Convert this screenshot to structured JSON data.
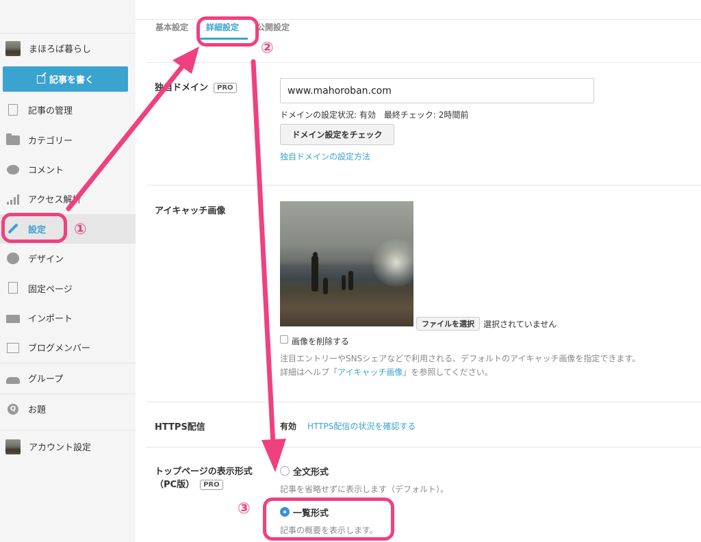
{
  "sidebar": {
    "blog_name": "まほろば暮らし",
    "write_label": "記事を書く",
    "items": [
      {
        "label": "記事の管理",
        "icon": "document-icon"
      },
      {
        "label": "カテゴリー",
        "icon": "folder-icon"
      },
      {
        "label": "コメント",
        "icon": "comment-icon"
      },
      {
        "label": "アクセス解析",
        "icon": "bar-chart-icon"
      },
      {
        "label": "設定",
        "icon": "wrench-icon",
        "active": true
      },
      {
        "label": "デザイン",
        "icon": "palette-icon"
      },
      {
        "label": "固定ページ",
        "icon": "page-icon"
      },
      {
        "label": "インポート",
        "icon": "truck-icon"
      },
      {
        "label": "ブログメンバー",
        "icon": "member-icon"
      }
    ],
    "group": "グループ",
    "odai": "お題",
    "odai_icon_letter": "Q",
    "account": "アカウント設定"
  },
  "tabs": [
    {
      "label": "基本設定"
    },
    {
      "label": "詳細設定",
      "active": true
    },
    {
      "label": "公開設定"
    }
  ],
  "domain": {
    "label": "独自ドメイン",
    "pro": "PRO",
    "value": "www.mahoroban.com",
    "status": "ドメインの設定状況: 有効　最終チェック: 2時間前",
    "check_button": "ドメイン設定をチェック",
    "help_link": "独自ドメインの設定方法"
  },
  "eyecatch": {
    "label": "アイキャッチ画像",
    "file_button": "ファイルを選択",
    "file_status": "選択されていません",
    "delete_label": "画像を削除する",
    "desc1": "注目エントリーやSNSシェアなどで利用される、デフォルトのアイキャッチ画像を指定できます。",
    "desc2_prefix": "詳細はヘルプ「",
    "desc2_link": "アイキャッチ画像",
    "desc2_suffix": "」を参照してください。"
  },
  "https": {
    "label": "HTTPS配信",
    "status": "有効",
    "link": "HTTPS配信の状況を確認する"
  },
  "toppage": {
    "label": "トップページの表示形式",
    "label2": "（PC版）",
    "pro": "PRO",
    "opt1_label": "全文形式",
    "opt1_desc": "記事を省略せずに表示します（デフォルト）。",
    "opt2_label": "一覧形式",
    "opt2_desc": "記事の概要を表示します。",
    "selected": "一覧形式"
  },
  "annotations": {
    "n1": "①",
    "n2": "②",
    "n3": "③",
    "color": "#f0407f"
  }
}
